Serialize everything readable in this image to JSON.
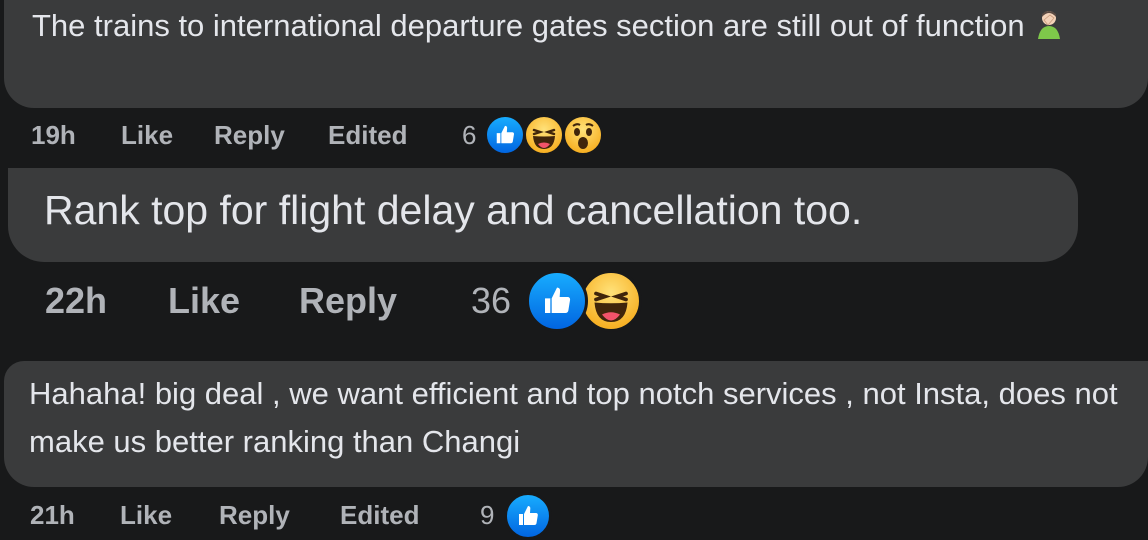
{
  "comments": [
    {
      "text": "The trains to international departure gates section are still out of function",
      "emoji": "person-facepalming-emoji",
      "time": "19h",
      "like_label": "Like",
      "reply_label": "Reply",
      "edited_label": "Edited",
      "reaction_count": "6",
      "reactions": [
        "like",
        "haha",
        "wow"
      ]
    },
    {
      "text": "Rank top for flight delay and cancellation too.",
      "time": "22h",
      "like_label": "Like",
      "reply_label": "Reply",
      "reaction_count": "36",
      "reactions": [
        "like",
        "haha"
      ]
    },
    {
      "text": "Hahaha! big deal , we want efficient and top notch services , not Insta, does not make us better ranking than Changi",
      "time": "21h",
      "like_label": "Like",
      "reply_label": "Reply",
      "edited_label": "Edited",
      "reaction_count": "9",
      "reactions": [
        "like"
      ]
    }
  ],
  "colors": {
    "background": "#18191a",
    "bubble": "#3a3b3c",
    "text": "#e4e6eb",
    "meta": "#b0b3b8",
    "like_blue": "#0866ff",
    "reaction_yellow": "#f7b125"
  }
}
